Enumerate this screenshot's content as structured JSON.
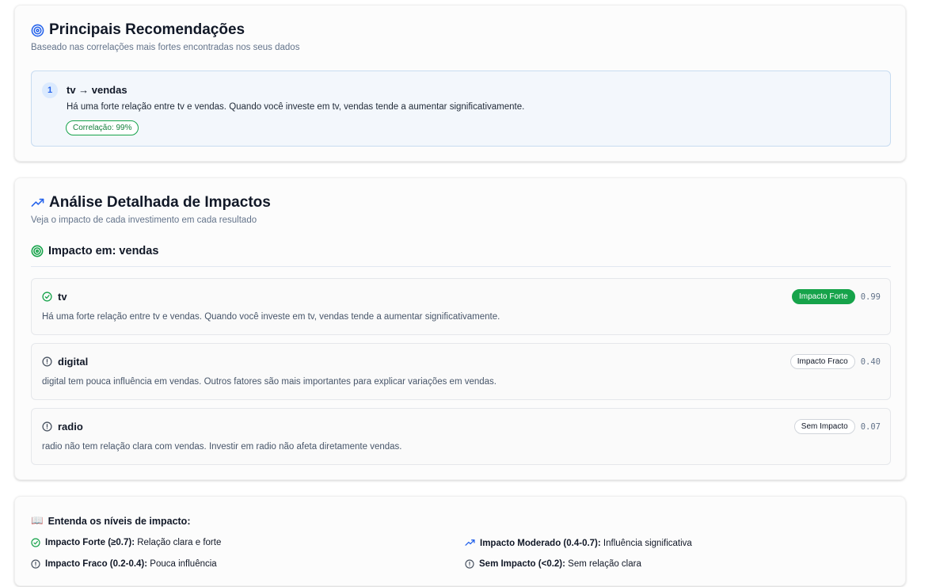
{
  "recommendations": {
    "title": "Principais Recomendações",
    "subtitle": "Baseado nas correlações mais fortes encontradas nos seus dados",
    "items": [
      {
        "number": "1",
        "title": "tv → vendas",
        "description": "Há uma forte relação entre tv e vendas. Quando você investe em tv, vendas tende a aumentar significativamente.",
        "correlation_label": "Correlação: 99%"
      }
    ]
  },
  "analysis": {
    "title": "Análise Detalhada de Impactos",
    "subtitle": "Veja o impacto de cada investimento em cada resultado",
    "target_heading": "Impacto em: vendas",
    "items": [
      {
        "name": "tv",
        "icon": "check-circle-icon",
        "badge": "Impacto Forte",
        "score": "0.99",
        "description": "Há uma forte relação entre tv e vendas. Quando você investe em tv, vendas tende a aumentar significativamente."
      },
      {
        "name": "digital",
        "icon": "alert-circle-icon",
        "badge": "Impacto Fraco",
        "score": "0.40",
        "description": "digital tem pouca influência em vendas. Outros fatores são mais importantes para explicar variações em vendas."
      },
      {
        "name": "radio",
        "icon": "alert-circle-icon",
        "badge": "Sem Impacto",
        "score": "0.07",
        "description": "radio não tem relação clara com vendas. Investir em radio não afeta diretamente vendas."
      }
    ]
  },
  "legend": {
    "icon": "📖",
    "title": "Entenda os níveis de impacto:",
    "items": [
      {
        "label": "Impacto Forte (≥0.7):",
        "text": "Relação clara e forte",
        "icon": "check-circle-icon"
      },
      {
        "label": "Impacto Moderado (0.4-0.7):",
        "text": "Influência significativa",
        "icon": "trending-up-icon"
      },
      {
        "label": "Impacto Fraco (0.2-0.4):",
        "text": "Pouca influência",
        "icon": "alert-circle-icon"
      },
      {
        "label": "Sem Impacto (<0.2):",
        "text": "Sem relação clara",
        "icon": "alert-circle-icon"
      }
    ]
  },
  "colors": {
    "accent_blue": "#2563eb",
    "green": "#16a34a",
    "muted": "#64748b"
  }
}
